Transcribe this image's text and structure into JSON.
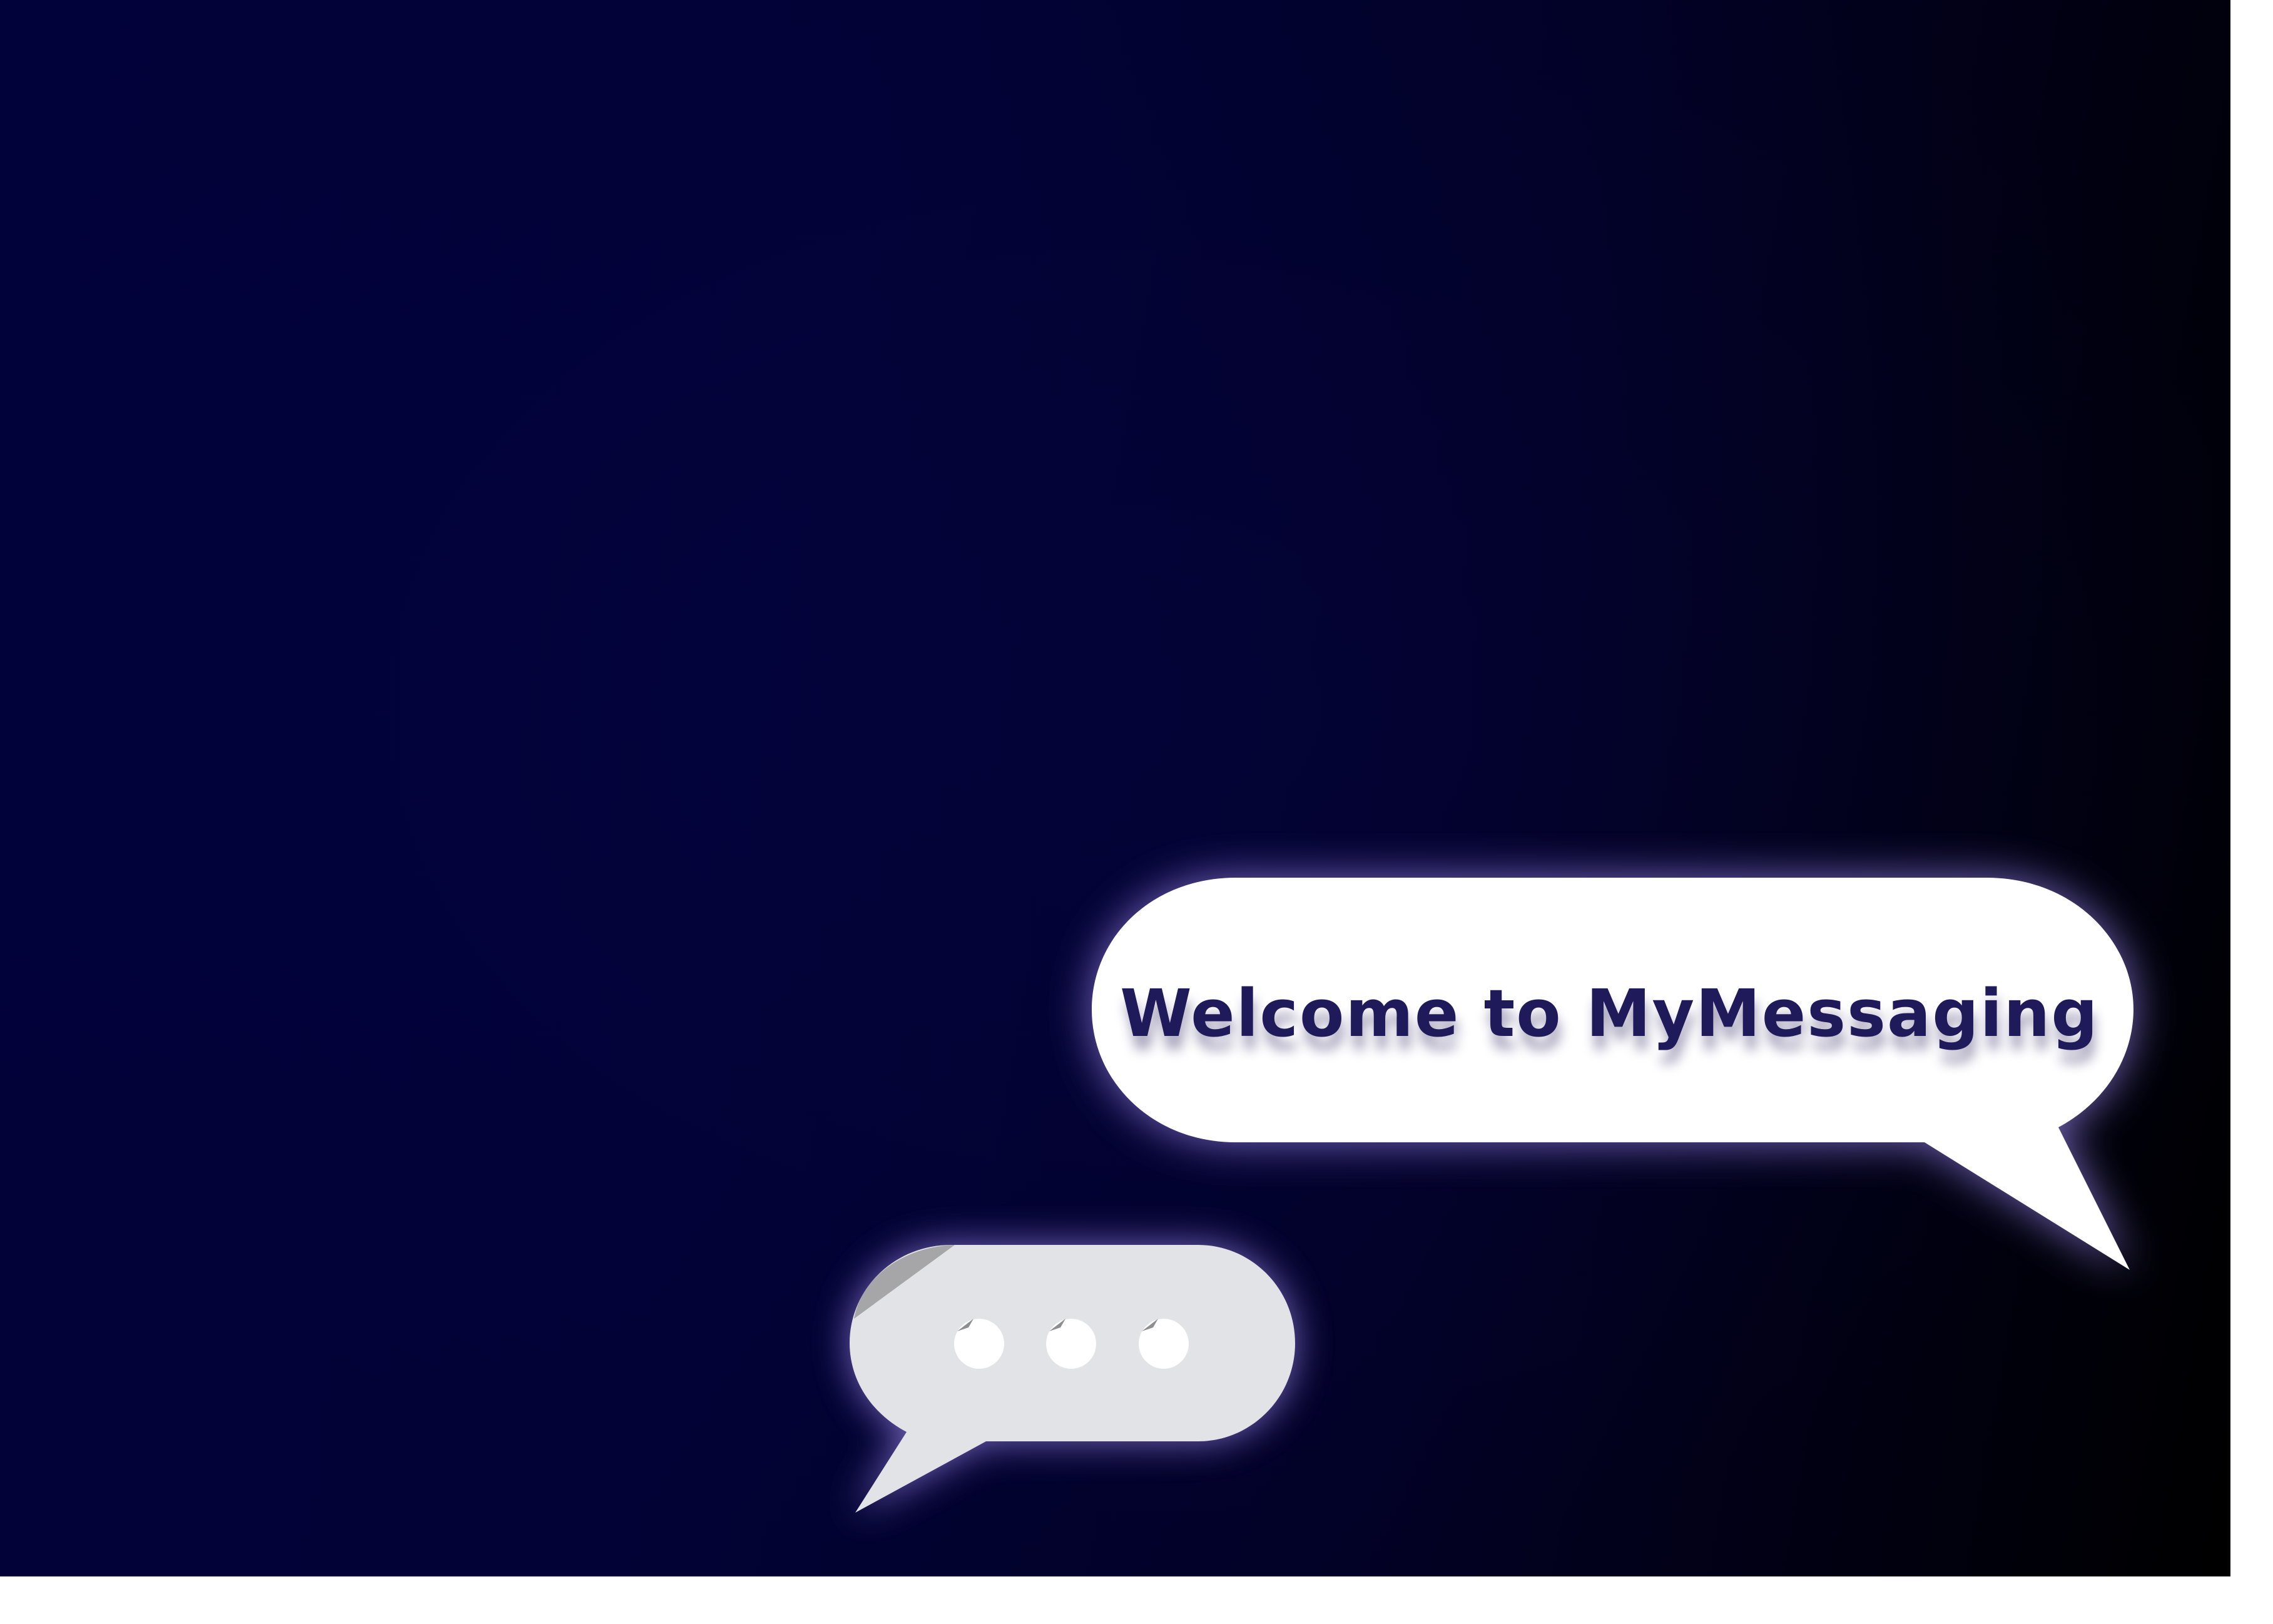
{
  "welcome": {
    "message": "Welcome to MyMessaging"
  },
  "typing_indicator": {
    "dots": 3
  },
  "colors": {
    "background_start": "#02023a",
    "background_end": "#000000",
    "bubble": "#ffffff",
    "typing_bubble": "#e2e3e6",
    "text": "#1f1a5a",
    "glow": "#8a78d6"
  },
  "icons": [
    "speech-bubble-icon",
    "typing-bubble-icon",
    "dot-icon"
  ]
}
